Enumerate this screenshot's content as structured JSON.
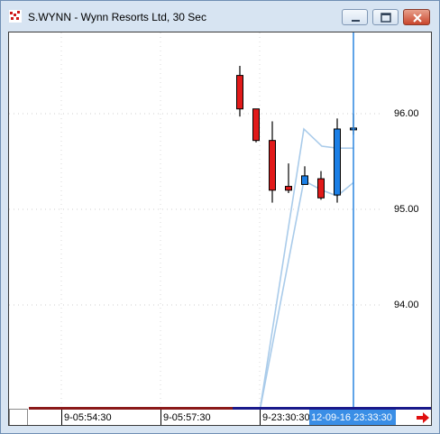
{
  "window": {
    "title": "S.WYNN - Wynn Resorts Ltd, 30 Sec"
  },
  "icons": {
    "app": "chart-app-icon",
    "minimize": "minimize-icon",
    "maximize": "maximize-icon",
    "close": "close-icon",
    "scroll": "scroll-right-arrow-icon"
  },
  "colors": {
    "down_candle": "#e11a1a",
    "up_candle": "#1b7fe6",
    "band_line": "#a9cbea",
    "cursor_line": "#2b86e0",
    "time_highlight": "#3a8ee6",
    "axis_dark_red": "#8b1a1a",
    "axis_navy": "#1a1a8b",
    "close_button": "#c9462c"
  },
  "price_axis": {
    "labels": [
      "96.00",
      "95.00",
      "94.00"
    ]
  },
  "time_axis": {
    "labels": [
      "9-05:54:30",
      "9-05:57:30",
      "9-23:30:30"
    ],
    "cursor_time": "12-09-16 23:33:30"
  },
  "chart_data": {
    "type": "candlestick",
    "title": "S.WYNN - Wynn Resorts Ltd, 30 Sec",
    "xlabel": "",
    "ylabel": "",
    "ylim": [
      92.9,
      97.0
    ],
    "y_ticks": [
      96.0,
      95.0,
      94.0
    ],
    "grid": true,
    "legend": "none",
    "candles": [
      {
        "open": 96.4,
        "high": 96.5,
        "low": 95.97,
        "close": 96.05,
        "direction": "down"
      },
      {
        "open": 96.05,
        "high": 96.05,
        "low": 95.7,
        "close": 95.72,
        "direction": "down"
      },
      {
        "open": 95.72,
        "high": 95.92,
        "low": 95.07,
        "close": 95.2,
        "direction": "down"
      },
      {
        "open": 95.24,
        "high": 95.48,
        "low": 95.17,
        "close": 95.2,
        "direction": "down"
      },
      {
        "open": 95.26,
        "high": 95.45,
        "low": 95.26,
        "close": 95.35,
        "direction": "up"
      },
      {
        "open": 95.32,
        "high": 95.4,
        "low": 95.1,
        "close": 95.12,
        "direction": "down"
      },
      {
        "open": 95.15,
        "high": 95.95,
        "low": 95.07,
        "close": 95.84,
        "direction": "up"
      },
      {
        "open": 95.85,
        "high": 96.0,
        "low": 95.78,
        "close": 95.85,
        "direction": "up"
      }
    ],
    "series": [
      {
        "values": [
          92.6,
          95.84,
          95.66,
          95.64,
          95.64
        ]
      },
      {
        "values": [
          92.6,
          95.3,
          95.2,
          95.14,
          95.28
        ]
      }
    ]
  }
}
